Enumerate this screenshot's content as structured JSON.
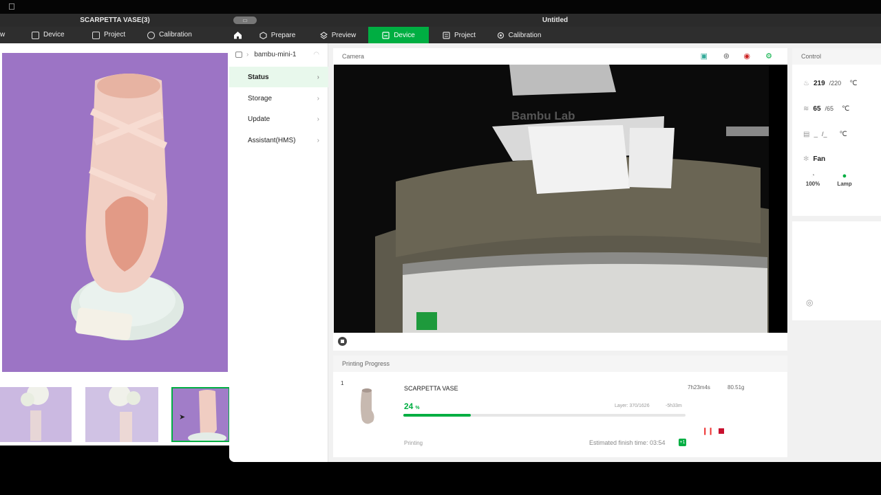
{
  "back_window": {
    "title": "SCARPETTA VASE(3)",
    "nav": [
      "w",
      "Device",
      "Project",
      "Calibration"
    ]
  },
  "front_window": {
    "title": "Untitled",
    "nav": {
      "home": "home-icon",
      "prepare": "Prepare",
      "preview": "Preview",
      "device": "Device",
      "project": "Project",
      "calibration": "Calibration"
    },
    "accent": "#00ae42"
  },
  "sidebar": {
    "device_name": "bambu-mini-1",
    "items": [
      {
        "label": "Status",
        "active": true
      },
      {
        "label": "Storage",
        "active": false
      },
      {
        "label": "Update",
        "active": false
      },
      {
        "label": "Assistant(HMS)",
        "active": false
      }
    ]
  },
  "camera": {
    "title": "Camera",
    "printer_brand": "Bambu Lab"
  },
  "progress": {
    "title": "Printing Progress",
    "plate": "1",
    "job_name": "SCARPETTA VASE",
    "time_remaining": "7h23m4s",
    "weight": "80.51g",
    "percent": "24",
    "percent_unit": "%",
    "percent_value": 24,
    "layer": "Layer: 370/1626",
    "delta": "-5h33m",
    "status": "Printing",
    "finish_time": "Estimated finish time: 03:54",
    "day_badge": "+1"
  },
  "control": {
    "title": "Control",
    "nozzle": {
      "current": "219",
      "target": "/220",
      "unit": "℃"
    },
    "bed": {
      "current": "65",
      "target": "/65",
      "unit": "℃"
    },
    "chamber": {
      "current": "_",
      "target": "/_",
      "unit": "℃"
    },
    "fan_label": "Fan",
    "speed_label": "100%",
    "lamp_label": "Lamp"
  }
}
